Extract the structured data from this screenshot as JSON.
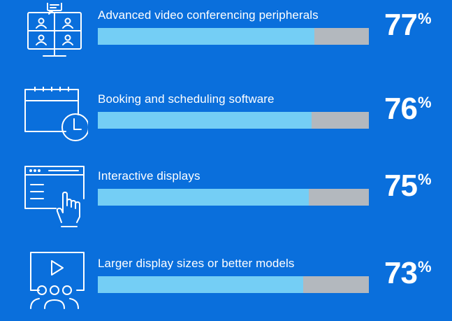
{
  "chart_data": {
    "type": "bar",
    "orientation": "horizontal",
    "categories": [
      "Advanced video conferencing peripherals",
      "Booking and scheduling software",
      "Interactive displays",
      "Larger display sizes or better models"
    ],
    "values": [
      77,
      76,
      75,
      73
    ],
    "value_labels": [
      "77",
      "76",
      "75",
      "73"
    ],
    "unit": "%",
    "xlim": [
      0,
      100
    ],
    "icons": [
      "video-conference-monitor-icon",
      "calendar-clock-icon",
      "interactive-display-touch-icon",
      "presentation-audience-icon"
    ],
    "colors": {
      "background": "#0a6fdc",
      "fill": "#74cef5",
      "track": "#b3b8be",
      "text": "#ffffff"
    },
    "grid": false,
    "legend": "none"
  }
}
